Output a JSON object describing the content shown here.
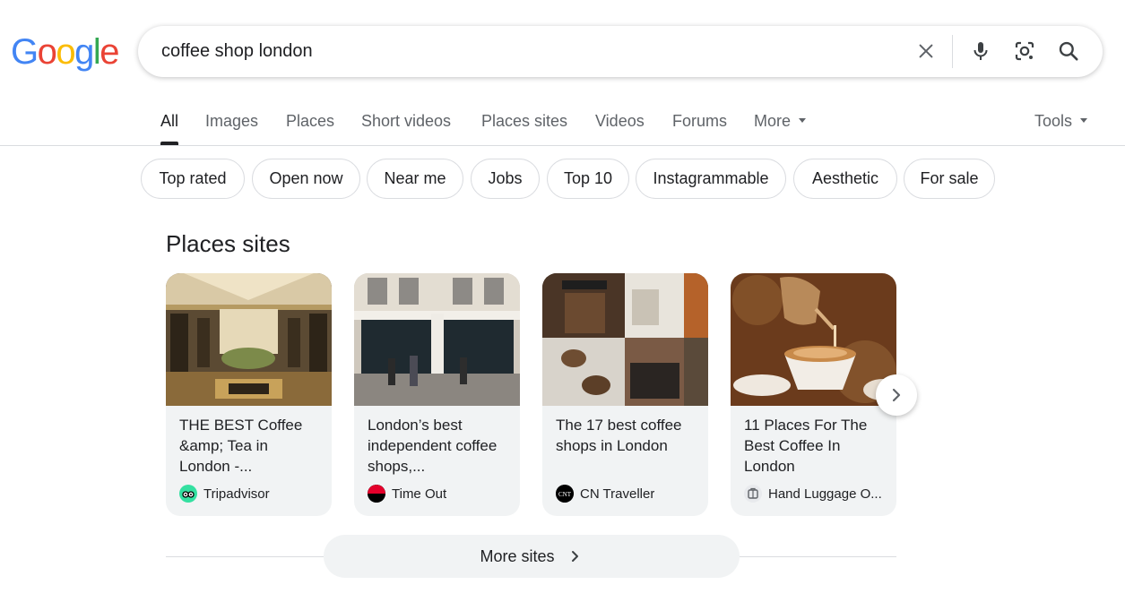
{
  "logo": {
    "letters": [
      "G",
      "o",
      "o",
      "g",
      "l",
      "e"
    ],
    "colors": [
      "#4285F4",
      "#EA4335",
      "#FBBC05",
      "#4285F4",
      "#34A853",
      "#EA4335"
    ]
  },
  "search": {
    "query": "coffee shop london"
  },
  "tabs": [
    {
      "label": "All"
    },
    {
      "label": "Images"
    },
    {
      "label": "Places"
    },
    {
      "label": "Short videos"
    },
    {
      "label": "Places sites"
    },
    {
      "label": "Videos"
    },
    {
      "label": "Forums"
    },
    {
      "label": "More"
    }
  ],
  "tools": {
    "label": "Tools"
  },
  "chips": [
    "Top rated",
    "Open now",
    "Near me",
    "Jobs",
    "Top 10",
    "Instagrammable",
    "Aesthetic",
    "For sale"
  ],
  "section": {
    "title": "Places sites"
  },
  "cards": [
    {
      "title": "THE BEST Coffee &amp; Tea in London -...",
      "source": "Tripadvisor",
      "favicon": "tripadvisor-icon"
    },
    {
      "title": "London’s best independent coffee shops,...",
      "source": "Time Out",
      "favicon": "timeout-icon"
    },
    {
      "title": "The 17 best coffee shops in London",
      "source": "CN Traveller",
      "favicon": "cnt-icon"
    },
    {
      "title": "11 Places For The Best Coffee In London",
      "source": "Hand Luggage O...",
      "favicon": "hand-luggage-icon"
    }
  ],
  "more_sites": {
    "label": "More sites"
  },
  "colors": {
    "accent_text": "#202124",
    "muted_text": "#5f6368",
    "border": "#dadce0",
    "card_bg": "#f1f3f4"
  }
}
